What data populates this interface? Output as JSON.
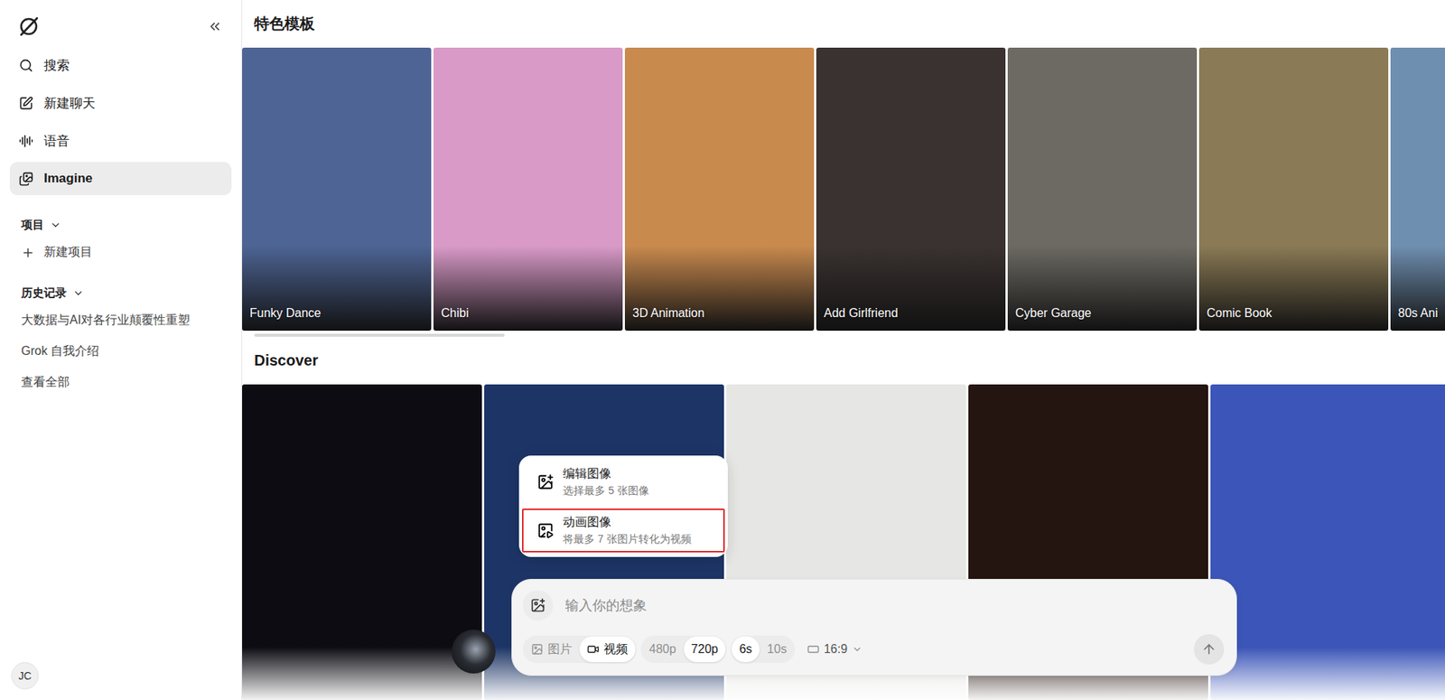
{
  "sidebar": {
    "nav": [
      {
        "label": "搜索",
        "selected": false
      },
      {
        "label": "新建聊天",
        "selected": false
      },
      {
        "label": "语音",
        "selected": false
      },
      {
        "label": "Imagine",
        "selected": true
      }
    ],
    "projects": {
      "label": "项目",
      "expanded": true,
      "new_item": "新建项目"
    },
    "history": {
      "label": "历史记录",
      "expanded": true,
      "items": [
        "大数据与AI对各行业颠覆性重塑",
        "Grok 自我介绍"
      ],
      "view_all": "查看全部"
    },
    "user": {
      "initials": "JC"
    }
  },
  "templates": {
    "title": "特色模板",
    "scroll_level": 0.21,
    "cards": [
      {
        "label": "Funky Dance",
        "color": "#4d6494"
      },
      {
        "label": "Chibi",
        "color": "#d99ac8"
      },
      {
        "label": "3D Animation",
        "color": "#c98a4e"
      },
      {
        "label": "Add Girlfriend",
        "color": "#3a3230"
      },
      {
        "label": "Cyber Garage",
        "color": "#6d6a63"
      },
      {
        "label": "Comic Book",
        "color": "#8a7a55"
      },
      {
        "label": "80s Ani",
        "color": "#6f8fb0"
      }
    ]
  },
  "discover": {
    "title": "Discover",
    "cards": [
      {
        "color": "#0c0c12"
      },
      {
        "color": "#1d3566"
      },
      {
        "color": "#e6e6e4"
      },
      {
        "color": "#241510"
      },
      {
        "color": "#3b55b8"
      }
    ]
  },
  "menu": {
    "items": [
      {
        "title": "编辑图像",
        "subtitle": "选择最多 5 张图像",
        "highlighted": false
      },
      {
        "title": "动画图像",
        "subtitle": "将最多 7 张图片转化为视频",
        "highlighted": true
      }
    ]
  },
  "composer": {
    "placeholder": "输入你的想象",
    "modes": [
      {
        "label": "图片",
        "selected": false
      },
      {
        "label": "视频",
        "selected": true
      }
    ],
    "resolutions": [
      {
        "label": "480p",
        "selected": false
      },
      {
        "label": "720p",
        "selected": true
      }
    ],
    "durations": [
      {
        "label": "6s",
        "selected": true
      },
      {
        "label": "10s",
        "selected": false
      }
    ],
    "aspect_ratio": "16:9"
  }
}
